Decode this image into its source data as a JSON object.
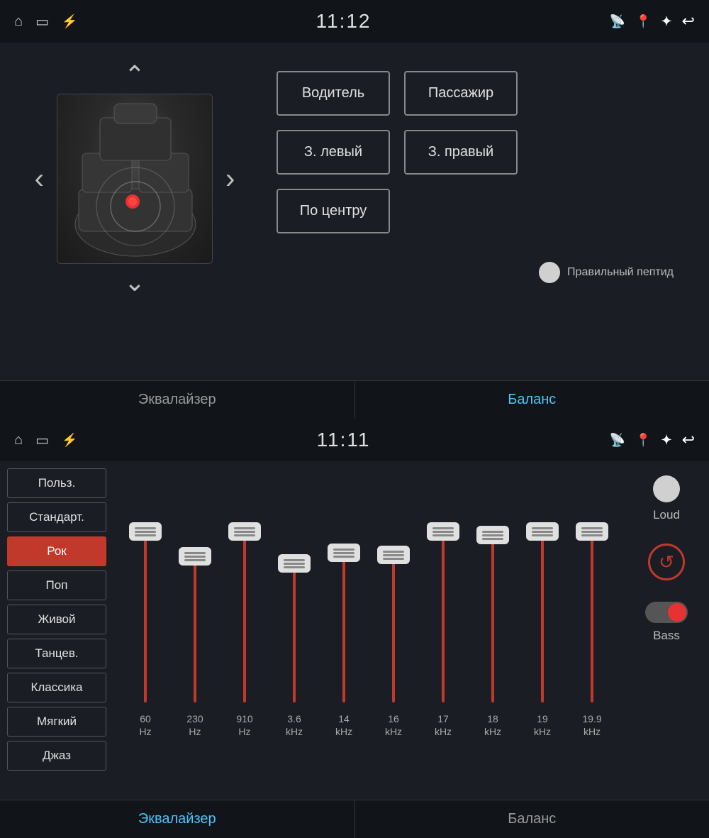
{
  "top": {
    "statusBar": {
      "time": "11:12",
      "icons": {
        "home": "⌂",
        "screen": "▭",
        "usb": "⚡",
        "cast": "⬛",
        "location": "📍",
        "bluetooth": "✦",
        "back": "↩"
      }
    },
    "buttons": {
      "driver": "Водитель",
      "passenger": "Пассажир",
      "rearLeft": "З. левый",
      "rearRight": "З. правый",
      "center": "По центру"
    },
    "toggle": {
      "label": "Правильный пептид"
    },
    "tabs": {
      "equalizer": "Эквалайзер",
      "balance": "Баланс"
    }
  },
  "bottom": {
    "statusBar": {
      "time": "11:11"
    },
    "presets": [
      {
        "label": "Польз.",
        "active": false
      },
      {
        "label": "Стандарт.",
        "active": false
      },
      {
        "label": "Рок",
        "active": true
      },
      {
        "label": "Поп",
        "active": false
      },
      {
        "label": "Живой",
        "active": false
      },
      {
        "label": "Танцев.",
        "active": false
      },
      {
        "label": "Классика",
        "active": false
      },
      {
        "label": "Мягкий",
        "active": false
      },
      {
        "label": "Джаз",
        "active": false
      }
    ],
    "sliders": [
      {
        "freq": "60",
        "unit": "Hz",
        "position": 0.1
      },
      {
        "freq": "230",
        "unit": "Hz",
        "position": 0.25
      },
      {
        "freq": "910",
        "unit": "Hz",
        "position": 0.1
      },
      {
        "freq": "3.6",
        "unit": "kHz",
        "position": 0.3
      },
      {
        "freq": "14",
        "unit": "kHz",
        "position": 0.2
      },
      {
        "freq": "16",
        "unit": "kHz",
        "position": 0.22
      },
      {
        "freq": "17",
        "unit": "kHz",
        "position": 0.1
      },
      {
        "freq": "18",
        "unit": "kHz",
        "position": 0.12
      },
      {
        "freq": "19",
        "unit": "kHz",
        "position": 0.1
      },
      {
        "freq": "19.9",
        "unit": "kHz",
        "position": 0.1
      }
    ],
    "controls": {
      "loud": "Loud",
      "bass": "Bass"
    },
    "tabs": {
      "equalizer": "Эквалайзер",
      "balance": "Баланс"
    }
  }
}
